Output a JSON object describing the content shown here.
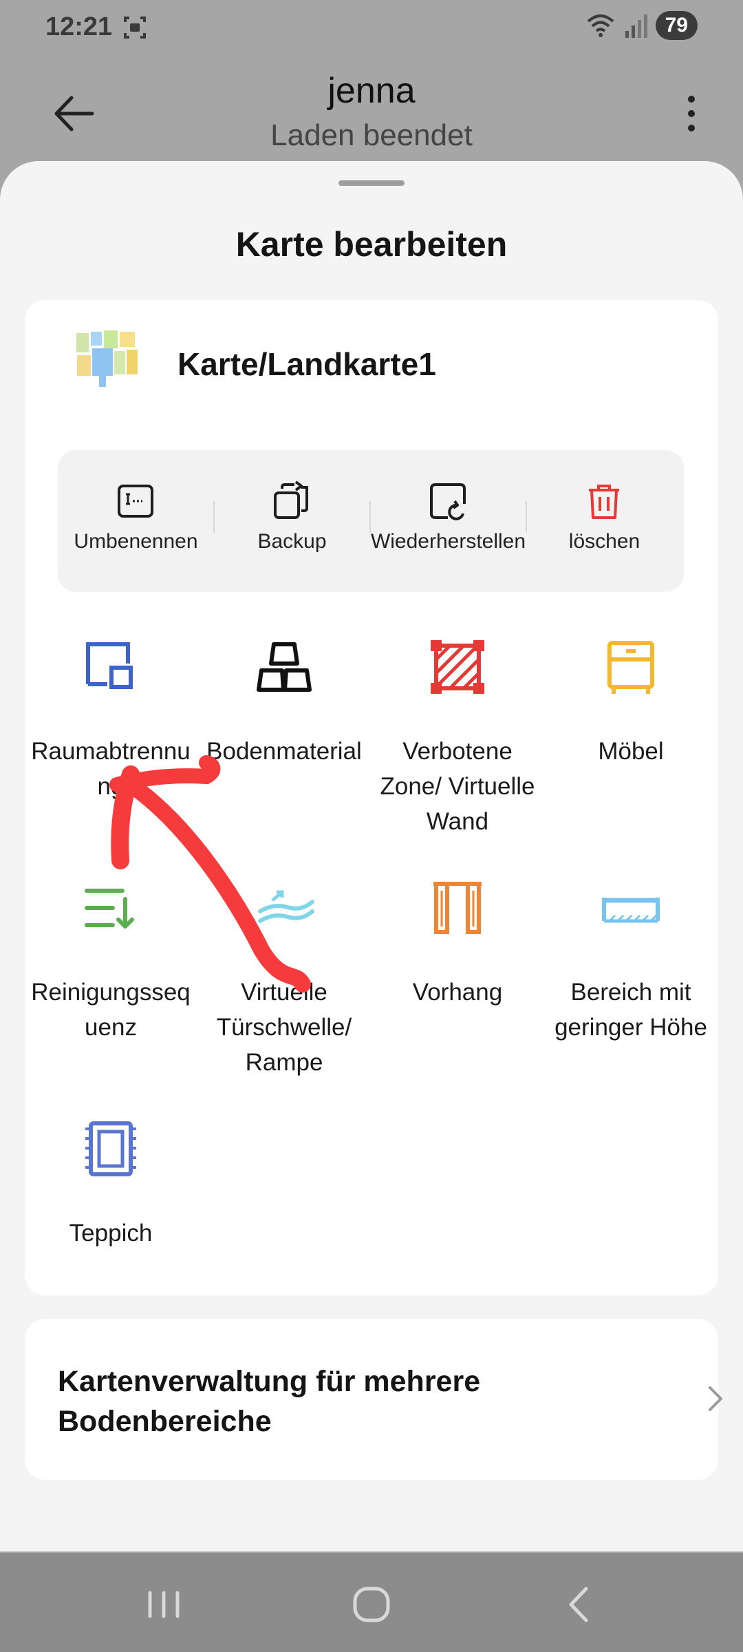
{
  "status": {
    "time": "12:21",
    "battery": "79"
  },
  "app": {
    "title": "jenna",
    "subtitle": "Laden beendet"
  },
  "sheet": {
    "title": "Karte bearbeiten"
  },
  "map": {
    "name": "Karte/Landkarte1"
  },
  "actions": [
    {
      "label": "Umbenennen",
      "icon": "rename-icon"
    },
    {
      "label": "Backup",
      "icon": "backup-icon"
    },
    {
      "label": "Wiederherstellen",
      "icon": "restore-icon"
    },
    {
      "label": "löschen",
      "icon": "trash-icon",
      "color": "#e53935"
    }
  ],
  "tools": [
    {
      "label": "Raumabtrennu ng",
      "icon": "room-divider-icon",
      "color": "#3b63c9"
    },
    {
      "label": "Bodenmaterial",
      "icon": "floor-material-icon",
      "color": "#111111"
    },
    {
      "label": "Verbotene Zone/ Virtuelle Wand",
      "icon": "no-go-zone-icon",
      "color": "#e53935"
    },
    {
      "label": "Möbel",
      "icon": "furniture-icon",
      "color": "#f2b830"
    },
    {
      "label": "Reinigungsseq uenz",
      "icon": "cleaning-sequence-icon",
      "color": "#5aae4e"
    },
    {
      "label": "Virtuelle Türschwelle/ Rampe",
      "icon": "threshold-icon",
      "color": "#7fd6e8"
    },
    {
      "label": "Vorhang",
      "icon": "curtain-icon",
      "color": "#ee8535"
    },
    {
      "label": "Bereich mit geringer Höhe",
      "icon": "low-area-icon",
      "color": "#77c4ef"
    },
    {
      "label": "Teppich",
      "icon": "carpet-icon",
      "color": "#5a74d1"
    }
  ],
  "multi_floor": {
    "label": "Kartenverwaltung für mehrere Bodenbereiche"
  }
}
